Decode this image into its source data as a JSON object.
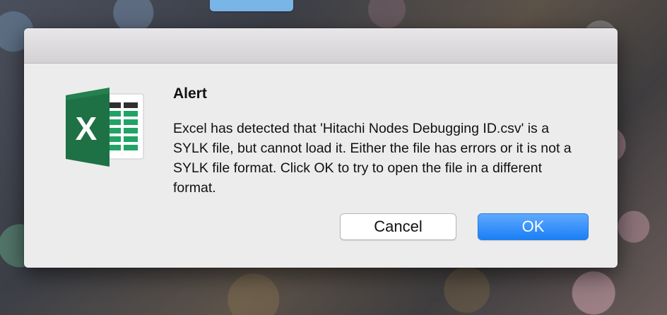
{
  "dialog": {
    "title": "Alert",
    "message": "Excel has detected that 'Hitachi Nodes Debugging ID.csv' is a SYLK file, but cannot load it. Either the file has errors or it is not a SYLK file format. Click OK to try to open the file in a different format.",
    "icon": "excel-app-icon",
    "icon_letter": "X",
    "buttons": {
      "cancel_label": "Cancel",
      "ok_label": "OK"
    }
  },
  "colors": {
    "excel_green": "#1e7145",
    "default_button": "#1a7ff6",
    "dialog_background": "#ececec"
  }
}
